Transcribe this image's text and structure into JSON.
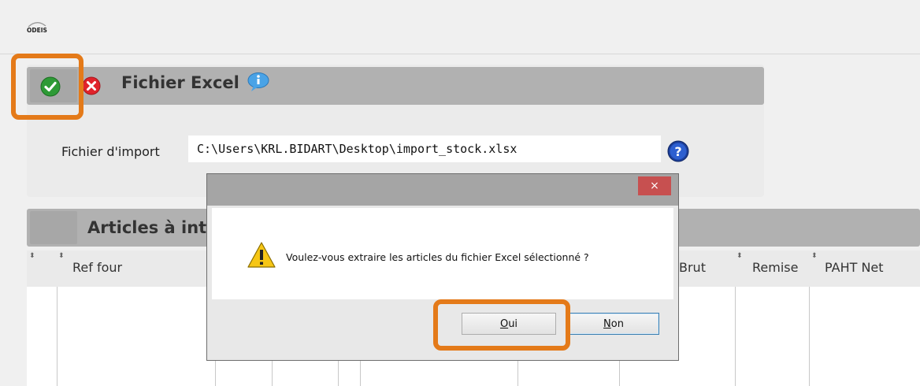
{
  "app": {
    "logo_text": "ODEIS"
  },
  "excel_panel": {
    "title": "Fichier Excel",
    "import_label": "Fichier d'import",
    "import_value": "C:\\Users\\KRL.BIDART\\Desktop\\import_stock.xlsx"
  },
  "grid": {
    "title": "Articles à int",
    "columns": [
      "Ref four",
      "Brut",
      "Remise",
      "PAHT Net"
    ]
  },
  "dialog": {
    "close_label": "×",
    "message": "Voulez-vous extraire les articles du fichier Excel sélectionné ?",
    "yes_mnemonic": "O",
    "yes_rest": "ui",
    "no_mnemonic": "N",
    "no_rest": "on"
  },
  "colors": {
    "highlight": "#e47a19",
    "panel_header": "#b1b1b1",
    "dialog_close": "#c75050"
  }
}
